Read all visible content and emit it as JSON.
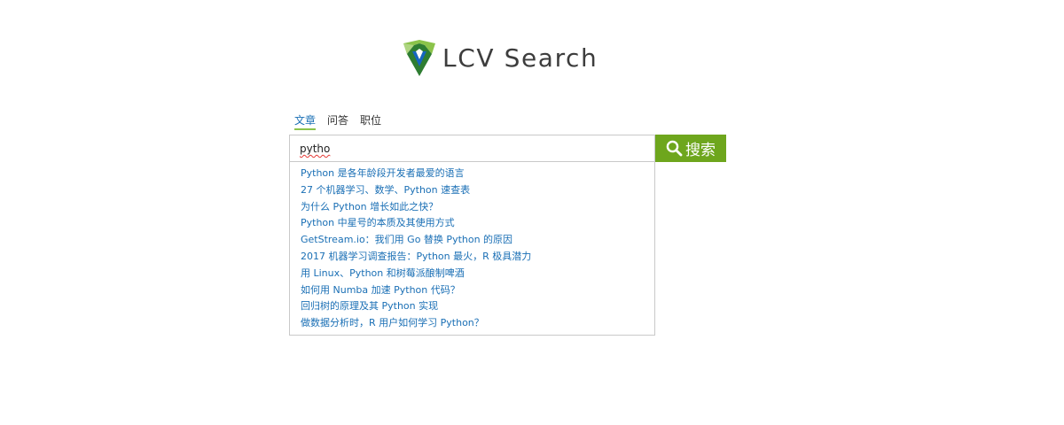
{
  "logo": {
    "text": "LCV Search",
    "icon": "lcv-shield-logo-icon",
    "colors": {
      "light_green": "#8bc34a",
      "dark_green": "#2e7d32",
      "blue": "#1565c0"
    }
  },
  "tabs": [
    {
      "label": "文章",
      "active": true
    },
    {
      "label": "问答",
      "active": false
    },
    {
      "label": "职位",
      "active": false
    }
  ],
  "search": {
    "value": "pytho",
    "button_label": "搜索",
    "button_icon": "search-icon",
    "button_color": "#6ea61d"
  },
  "suggestions": [
    "Python 是各年龄段开发者最爱的语言",
    "27 个机器学习、数学、Python 速查表",
    "为什么 Python 增长如此之快？",
    "Python 中星号的本质及其使用方式",
    "GetStream.io：我们用 Go 替换 Python 的原因",
    "2017 机器学习调查报告：Python 最火，R 极具潜力",
    "用 Linux、Python 和树莓派酿制啤酒",
    "如何用 Numba 加速 Python 代码？",
    "回归树的原理及其 Python 实现",
    "做数据分析时，R 用户如何学习 Python？"
  ],
  "link_color": "#1a6fb5"
}
